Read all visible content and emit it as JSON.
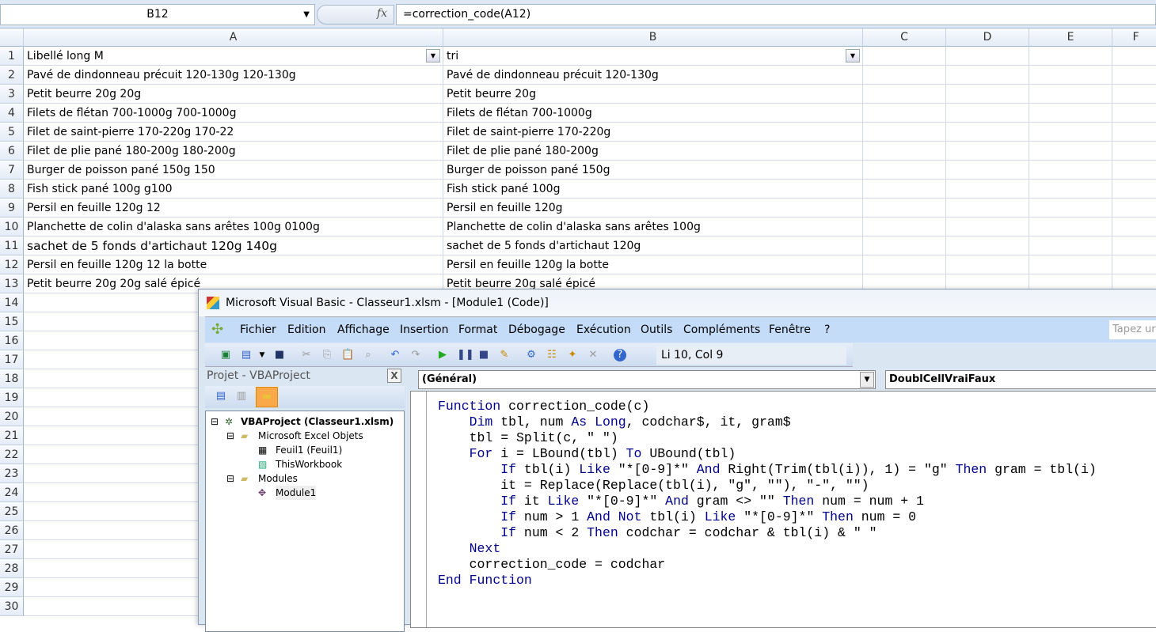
{
  "formula_bar": {
    "name_box": "B12",
    "fx": "fx",
    "formula": "=correction_code(A12)"
  },
  "columns": [
    "A",
    "B",
    "C",
    "D",
    "E",
    "F"
  ],
  "rows": [
    {
      "n": "1",
      "a": "Libellé long M",
      "b": "tri"
    },
    {
      "n": "2",
      "a": "Pavé de dindonneau précuit 120-130g 120-130g",
      "b": "Pavé de dindonneau précuit 120-130g"
    },
    {
      "n": "3",
      "a": "Petit beurre 20g 20g",
      "b": "Petit beurre 20g"
    },
    {
      "n": "4",
      "a": "Filets de flétan 700-1000g 700-1000g",
      "b": "Filets de flétan 700-1000g"
    },
    {
      "n": "5",
      "a": "Filet de saint-pierre 170-220g 170-22",
      "b": "Filet de saint-pierre 170-220g"
    },
    {
      "n": "6",
      "a": "Filet de plie pané 180-200g 180-200g",
      "b": "Filet de plie pané 180-200g"
    },
    {
      "n": "7",
      "a": "Burger de poisson pané 150g 150",
      "b": "Burger de poisson pané 150g"
    },
    {
      "n": "8",
      "a": "Fish stick pané 100g g100",
      "b": "Fish stick pané 100g"
    },
    {
      "n": "9",
      "a": "Persil en feuille 120g 12",
      "b": "Persil en feuille 120g"
    },
    {
      "n": "10",
      "a": "Planchette de colin d'alaska sans arêtes 100g 0100g",
      "b": "Planchette de colin d'alaska sans arêtes 100g"
    },
    {
      "n": "11",
      "a": "sachet de 5 fonds d'artichaut 120g 140g",
      "b": "sachet de 5 fonds d'artichaut 120g"
    },
    {
      "n": "12",
      "a": "Persil en feuille 120g 12 la botte",
      "b": "Persil en feuille 120g la botte"
    },
    {
      "n": "13",
      "a": "Petit beurre 20g 20g salé épicé",
      "b": "Petit beurre 20g salé épicé"
    }
  ],
  "empty_rows": [
    "14",
    "15",
    "16",
    "17",
    "18",
    "19",
    "20",
    "21",
    "22",
    "23",
    "24",
    "25",
    "26",
    "27",
    "28",
    "29",
    "30"
  ],
  "vbe": {
    "title": "Microsoft Visual Basic - Classeur1.xlsm - [Module1 (Code)]",
    "menu": [
      "Fichier",
      "Edition",
      "Affichage",
      "Insertion",
      "Format",
      "Débogage",
      "Exécution",
      "Outils",
      "Compléments",
      "Fenêtre",
      "?"
    ],
    "search_placeholder": "Tapez ur",
    "position": "Li 10, Col 9",
    "project": {
      "title": "Projet - VBAProject",
      "close": "X",
      "tree": [
        "VBAProject (Classeur1.xlsm)",
        "Microsoft Excel Objets",
        "Feuil1 (Feuil1)",
        "ThisWorkbook",
        "Modules",
        "Module1"
      ]
    },
    "object_combo": "(Général)",
    "proc_combo": "DoublCellVraiFaux",
    "code": [
      "Function correction_code(c)",
      "    Dim tbl, num As Long, codchar$, it, gram$",
      "    tbl = Split(c, \" \")",
      "    For i = LBound(tbl) To UBound(tbl)",
      "        If tbl(i) Like \"*[0-9]*\" And Right(Trim(tbl(i)), 1) = \"g\" Then gram = tbl(i)",
      "        it = Replace(Replace(tbl(i), \"g\", \"\"), \"-\", \"\")",
      "        If it Like \"*[0-9]*\" And gram <> \"\" Then num = num + 1",
      "        If num > 1 And Not tbl(i) Like \"*[0-9]*\" Then num = 0",
      "        If num < 2 Then codchar = codchar & tbl(i) & \" \"",
      "    Next",
      "    correction_code = codchar",
      "End Function"
    ]
  }
}
